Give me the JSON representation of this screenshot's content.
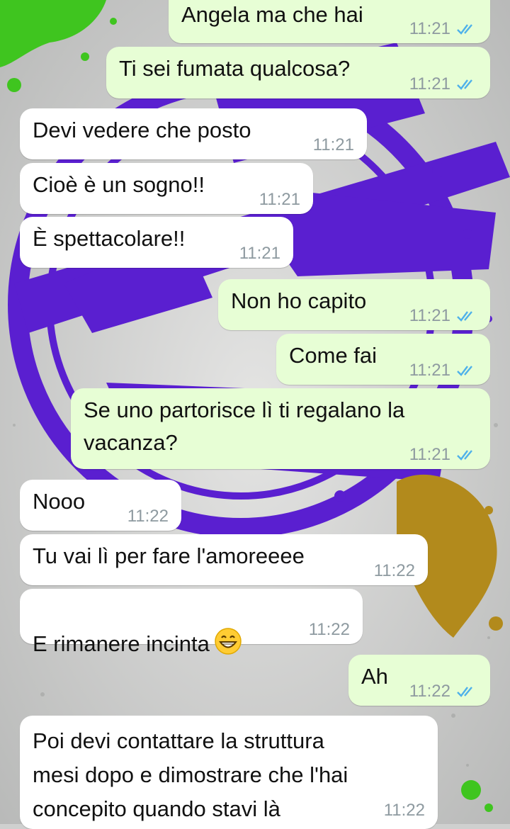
{
  "colors": {
    "outgoing_bubble": "#e7fed5",
    "incoming_bubble": "#ffffff",
    "tick_read": "#4fb1ea",
    "timestamp": "#8e9aa0",
    "wallpaper_purple": "#5a1fd0",
    "wallpaper_green": "#3fc51f",
    "wallpaper_gold": "#b28a1c"
  },
  "messages": [
    {
      "direction": "out",
      "text": "Angela ma che hai",
      "time": "11:21",
      "status": "read-ticks-icon"
    },
    {
      "direction": "out",
      "text": "Ti sei fumata qualcosa?",
      "time": "11:21",
      "status": "read-ticks-icon"
    },
    {
      "direction": "in",
      "text": "Devi vedere che posto",
      "time": "11:21"
    },
    {
      "direction": "in",
      "text": "Cioè è un sogno!!",
      "time": "11:21"
    },
    {
      "direction": "in",
      "text": "È spettacolare!!",
      "time": "11:21"
    },
    {
      "direction": "out",
      "text": "Non ho capito",
      "time": "11:21",
      "status": "read-ticks-icon"
    },
    {
      "direction": "out",
      "text": "Come fai",
      "time": "11:21",
      "status": "read-ticks-icon"
    },
    {
      "direction": "out",
      "text": "Se uno partorisce lì ti regalano la\nvacanza?",
      "time": "11:21",
      "status": "read-ticks-icon"
    },
    {
      "direction": "in",
      "text": "Nooo",
      "time": "11:22"
    },
    {
      "direction": "in",
      "text": "Tu vai lì per fare l'amoreeee",
      "time": "11:22"
    },
    {
      "direction": "in",
      "text": "E rimanere incinta",
      "emoji": "grinning-face-icon",
      "time": "11:22"
    },
    {
      "direction": "out",
      "text": "Ah",
      "time": "11:22",
      "status": "read-ticks-icon"
    },
    {
      "direction": "in",
      "text": "Poi devi contattare la struttura\nmesi dopo e dimostrare che l'hai\nconcepito quando stavi là",
      "time": "11:22"
    }
  ]
}
